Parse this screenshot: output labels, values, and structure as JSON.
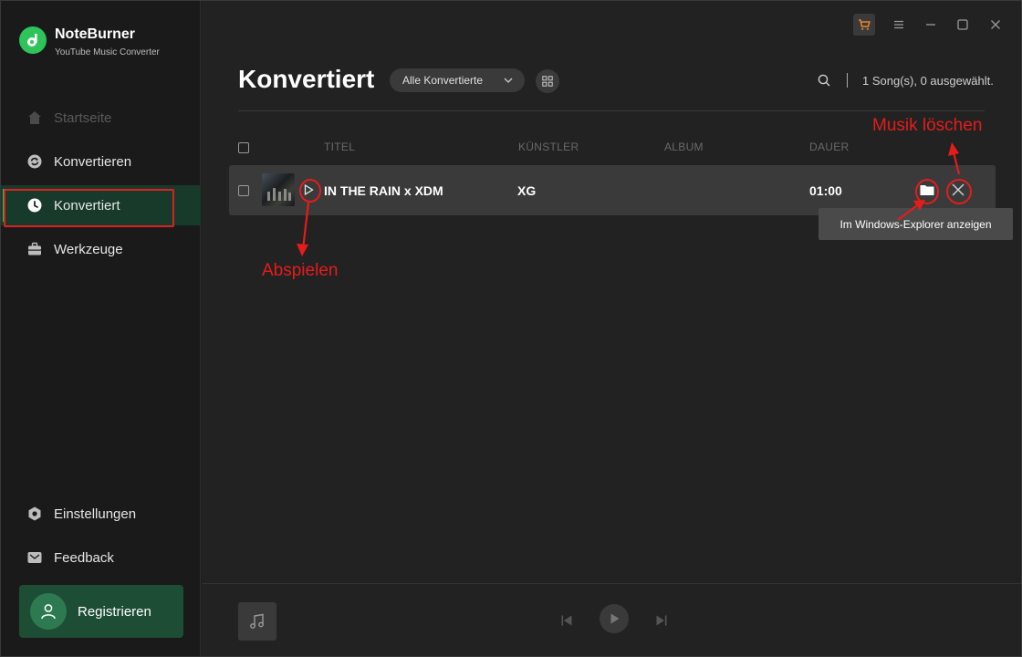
{
  "app": {
    "name": "NoteBurner",
    "subtitle": "YouTube Music Converter"
  },
  "sidebar": {
    "items": [
      {
        "label": "Startseite",
        "icon": "home-icon",
        "state": "disabled"
      },
      {
        "label": "Konvertieren",
        "icon": "refresh-icon",
        "state": "normal"
      },
      {
        "label": "Konvertiert",
        "icon": "clock-icon",
        "state": "active"
      },
      {
        "label": "Werkzeuge",
        "icon": "toolbox-icon",
        "state": "normal"
      }
    ],
    "bottom": [
      {
        "label": "Einstellungen",
        "icon": "gear-icon"
      },
      {
        "label": "Feedback",
        "icon": "mail-icon"
      }
    ],
    "register_label": "Registrieren"
  },
  "main": {
    "title": "Konvertiert",
    "filter_label": "Alle Konvertierte",
    "count_text": "1 Song(s), 0 ausgewählt.",
    "columns": {
      "title": "TITEL",
      "artist": "KÜNSTLER",
      "album": "ALBUM",
      "duration": "DAUER"
    },
    "rows": [
      {
        "title": "IN THE RAIN x XDM",
        "artist": "XG",
        "album": "",
        "duration": "01:00"
      }
    ],
    "tooltip": "Im Windows-Explorer anzeigen"
  },
  "annotations": {
    "play": "Abspielen",
    "delete": "Musik löschen"
  },
  "colors": {
    "accent": "#2ec35b",
    "annotation": "#e51c1c",
    "cart": "#e8862a"
  }
}
